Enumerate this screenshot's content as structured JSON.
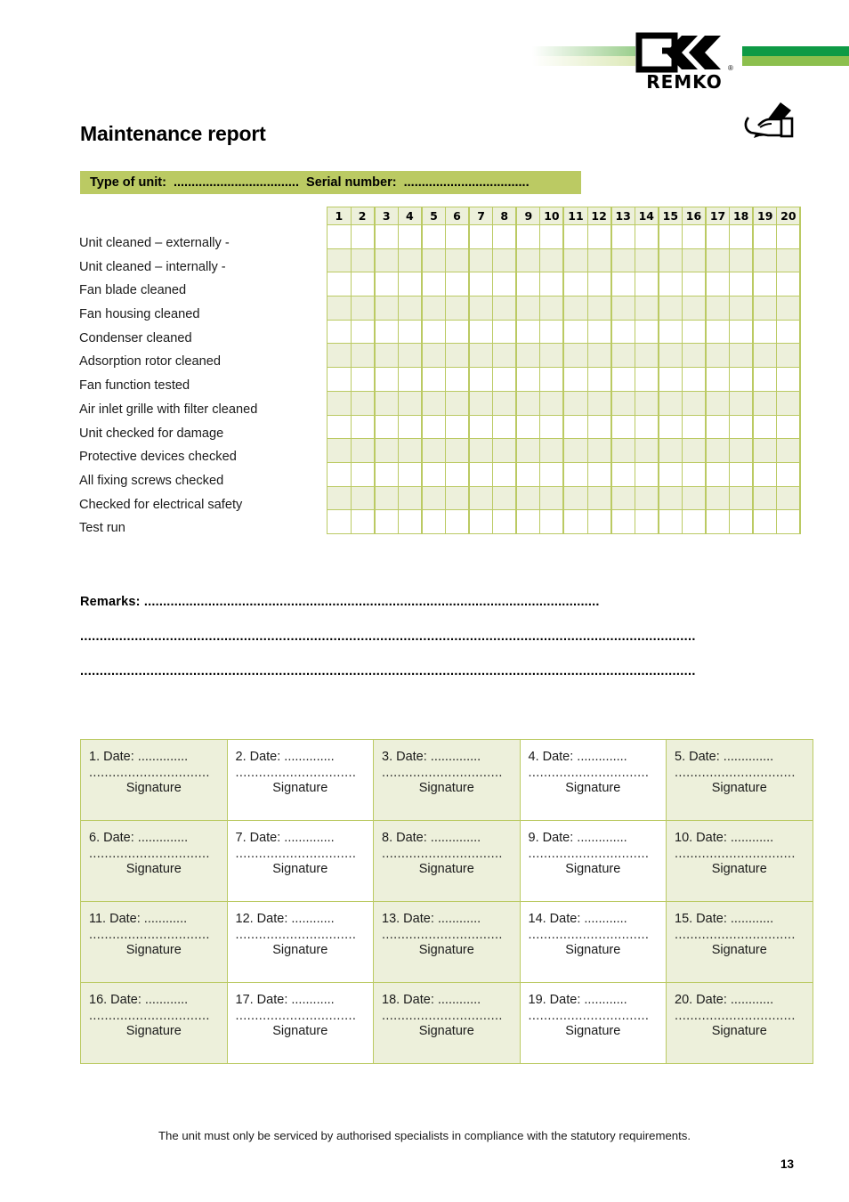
{
  "brand": {
    "logo_name": "REMKO",
    "registered_mark": "®",
    "bar_dark_color": "#0e9a45",
    "bar_light_color": "#8cbf4d"
  },
  "header": {
    "title": "Maintenance report"
  },
  "unit_banner": {
    "text": "Type of unit:  ...................................  Serial number:  ...................................",
    "background_color": "#bbca63"
  },
  "checklist": {
    "items": [
      "Unit cleaned – externally -",
      "Unit cleaned – internally -",
      "Fan blade cleaned",
      "Fan housing cleaned",
      "Condenser cleaned",
      "Adsorption rotor cleaned",
      "Fan function tested",
      "Air inlet grille with filter cleaned",
      "Unit checked for damage",
      "Protective devices checked",
      "All fixing screws checked",
      "Checked for electrical safety",
      "Test run"
    ]
  },
  "grid": {
    "column_headers": [
      "1",
      "2",
      "3",
      "4",
      "5",
      "6",
      "7",
      "8",
      "9",
      "10",
      "11",
      "12",
      "13",
      "14",
      "15",
      "16",
      "17",
      "18",
      "19",
      "20"
    ],
    "row_count": 13,
    "cell_values": [],
    "border_color": "#bbca63",
    "shaded_row_color": "#edf0db"
  },
  "remarks": {
    "label": "Remarks:",
    "line1_dots": " .........................................................................................................................",
    "line2_dots": "..............................................................................................................................................................",
    "line3_dots": ".............................................................................................................................................................."
  },
  "signatures": {
    "signature_label": "Signature",
    "cells": [
      {
        "number": "1.",
        "date_label": "Date:",
        "date_dots": " ..............",
        "line_dots": "..............................."
      },
      {
        "number": "2.",
        "date_label": "Date:",
        "date_dots": " ..............",
        "line_dots": "..............................."
      },
      {
        "number": "3.",
        "date_label": "Date:",
        "date_dots": " ..............",
        "line_dots": "..............................."
      },
      {
        "number": "4.",
        "date_label": "Date:",
        "date_dots": " ..............",
        "line_dots": "..............................."
      },
      {
        "number": "5.",
        "date_label": "Date:",
        "date_dots": " ..............",
        "line_dots": "..............................."
      },
      {
        "number": "6.",
        "date_label": "Date:",
        "date_dots": " ..............",
        "line_dots": "..............................."
      },
      {
        "number": "7.",
        "date_label": "Date:",
        "date_dots": " ..............",
        "line_dots": "..............................."
      },
      {
        "number": "8.",
        "date_label": "Date:",
        "date_dots": " ..............",
        "line_dots": "..............................."
      },
      {
        "number": "9.",
        "date_label": "Date:",
        "date_dots": " ..............",
        "line_dots": "..............................."
      },
      {
        "number": "10.",
        "date_label": "Date:",
        "date_dots": " ............",
        "line_dots": "..............................."
      },
      {
        "number": "11.",
        "date_label": "Date:",
        "date_dots": " ............",
        "line_dots": "..............................."
      },
      {
        "number": "12.",
        "date_label": "Date:",
        "date_dots": " ............",
        "line_dots": "..............................."
      },
      {
        "number": "13.",
        "date_label": "Date:",
        "date_dots": " ............",
        "line_dots": "..............................."
      },
      {
        "number": "14.",
        "date_label": "Date:",
        "date_dots": " ............",
        "line_dots": "..............................."
      },
      {
        "number": "15.",
        "date_label": "Date:",
        "date_dots": " ............",
        "line_dots": "..............................."
      },
      {
        "number": "16.",
        "date_label": "Date:",
        "date_dots": " ............",
        "line_dots": "..............................."
      },
      {
        "number": "17.",
        "date_label": "Date:",
        "date_dots": " ............",
        "line_dots": "..............................."
      },
      {
        "number": "18.",
        "date_label": "Date:",
        "date_dots": " ............",
        "line_dots": "..............................."
      },
      {
        "number": "19.",
        "date_label": "Date:",
        "date_dots": " ............",
        "line_dots": "..............................."
      },
      {
        "number": "20.",
        "date_label": "Date:",
        "date_dots": " ............",
        "line_dots": "..............................."
      }
    ]
  },
  "footer": {
    "note": "The unit must only be serviced by authorised specialists in compliance with the statutory requirements.",
    "page_number": "13"
  }
}
